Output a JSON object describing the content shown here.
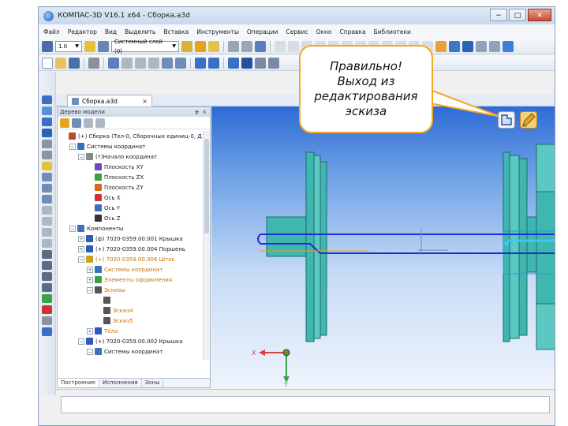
{
  "window": {
    "title": "КОМПАС-3D V16.1 x64 - Сборка.a3d",
    "min_label": "−",
    "max_label": "□",
    "close_label": "✕"
  },
  "menu": [
    "Файл",
    "Редактор",
    "Вид",
    "Выделить",
    "Вставка",
    "Инструменты",
    "Операции",
    "Сервис",
    "Окно",
    "Справка",
    "Библиотеки"
  ],
  "toolbar": {
    "scale_value": "1.0",
    "layer_value": "Системный слой (0)"
  },
  "document_tab": {
    "label": "Сборка.a3d",
    "close_label": "×"
  },
  "tree": {
    "header": "Дерево модели",
    "pin_label": "ᵽ",
    "close_label": "×",
    "rows": [
      {
        "text": "(+) Сборка (Тел-0, Сборочных единиц-0, Д",
        "indent": 0,
        "toggle": "",
        "icon": "#b34b2e",
        "style": ""
      },
      {
        "text": "Системы координат",
        "indent": 1,
        "toggle": "−",
        "icon": "#3a6fc4",
        "style": ""
      },
      {
        "text": "(т)Начало координат",
        "indent": 2,
        "toggle": "−",
        "icon": "#888888",
        "style": ""
      },
      {
        "text": "Плоскость XY",
        "indent": 3,
        "toggle": "",
        "icon": "#6b48c8",
        "style": ""
      },
      {
        "text": "Плоскость ZX",
        "indent": 3,
        "toggle": "",
        "icon": "#3aa04a",
        "style": ""
      },
      {
        "text": "Плоскость ZY",
        "indent": 3,
        "toggle": "",
        "icon": "#d96a1c",
        "style": ""
      },
      {
        "text": "Ось X",
        "indent": 3,
        "toggle": "",
        "icon": "#c33",
        "style": ""
      },
      {
        "text": "Ось Y",
        "indent": 3,
        "toggle": "",
        "icon": "#3a6fc4",
        "style": ""
      },
      {
        "text": "Ось Z",
        "indent": 3,
        "toggle": "",
        "icon": "#333333",
        "style": ""
      },
      {
        "text": "Компоненты",
        "indent": 1,
        "toggle": "−",
        "icon": "#3a6fc4",
        "style": ""
      },
      {
        "text": "(ф) 7020-0359.00.001 Крышка",
        "indent": 2,
        "toggle": "+",
        "icon": "#2a5cb8",
        "style": ""
      },
      {
        "text": "(+) 7020-0359.00.004 Поршень",
        "indent": 2,
        "toggle": "+",
        "icon": "#2a5cb8",
        "style": ""
      },
      {
        "text": "(+) 7020-0359.00.006 Шток",
        "indent": 2,
        "toggle": "−",
        "icon": "#c9a21a",
        "style": "orange"
      },
      {
        "text": "Системы координат",
        "indent": 3,
        "toggle": "+",
        "icon": "#3a6fc4",
        "style": "orange"
      },
      {
        "text": "Элементы оформления",
        "indent": 3,
        "toggle": "+",
        "icon": "#3aa04a",
        "style": "orange"
      },
      {
        "text": "Эскизы",
        "indent": 3,
        "toggle": "−",
        "icon": "#555555",
        "style": "orange"
      },
      {
        "text": "",
        "indent": 4,
        "toggle": "",
        "icon": "#555555",
        "style": ""
      },
      {
        "text": "Эскиз4",
        "indent": 4,
        "toggle": "",
        "icon": "#555555",
        "style": "orange"
      },
      {
        "text": "Эскиз5",
        "indent": 4,
        "toggle": "",
        "icon": "#555555",
        "style": "orange"
      },
      {
        "text": "Тела",
        "indent": 3,
        "toggle": "+",
        "icon": "#2a5cb8",
        "style": "orange"
      },
      {
        "text": "(+) 7020-0359.00.002 Крышка",
        "indent": 2,
        "toggle": "−",
        "icon": "#2a5cb8",
        "style": ""
      },
      {
        "text": "Системы координат",
        "indent": 3,
        "toggle": "−",
        "icon": "#3a6fc4",
        "style": ""
      }
    ],
    "tabs": [
      "Построение",
      "Исполнения",
      "Зоны"
    ]
  },
  "viewport": {
    "axis_x_label": "X",
    "axis_y_label": "Y"
  },
  "callout": {
    "lines": [
      "Правильно!",
      "Выход из",
      "редактирования",
      "эскиза"
    ]
  },
  "colors": {
    "callout_border": "#f5a623",
    "part_fill": "#3fb6b0",
    "sketch_line": "#1a2fd6"
  }
}
